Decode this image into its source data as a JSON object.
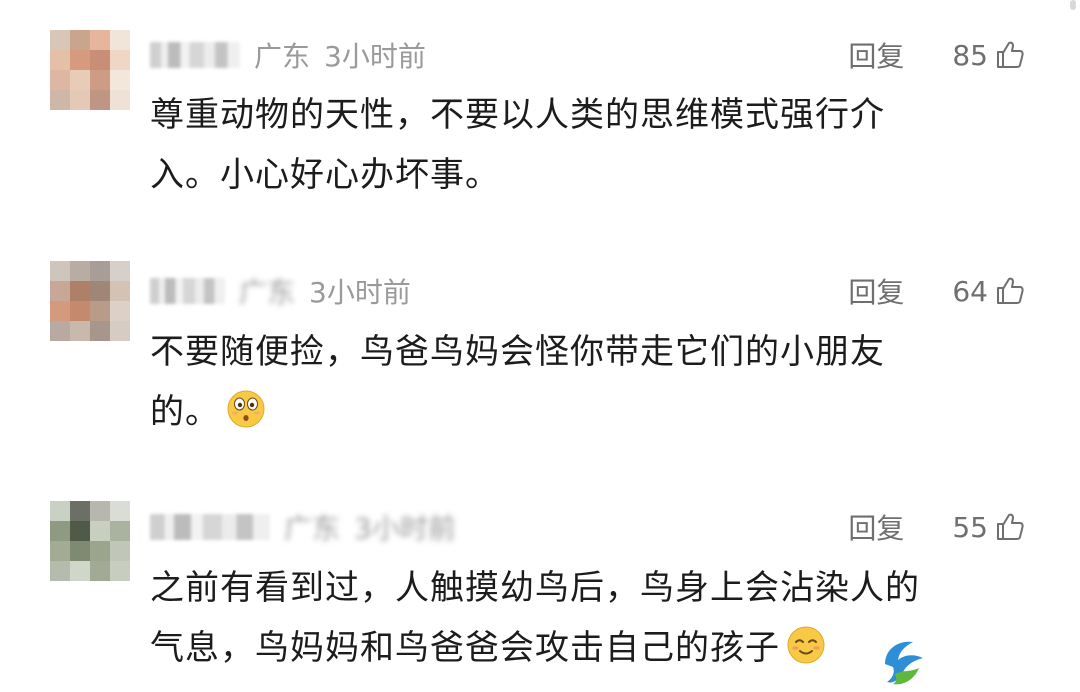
{
  "comments": [
    {
      "location": "广东",
      "time": "3小时前",
      "reply_label": "回复",
      "likes": "85",
      "text_lines": [
        "尊重动物的天性，不要以人类的思维模式强行介",
        "入。小心好心办坏事。"
      ],
      "avatar_colors": [
        "#d8c7b8",
        "#c9a58e",
        "#e7b59c",
        "#f1e4d9",
        "#e4c0a6",
        "#d69a7e",
        "#c98e77",
        "#f0d7c5",
        "#ddb7a1",
        "#e9ccb8",
        "#ce9b85",
        "#f3e6db",
        "#cdb7a8",
        "#e3c9b6",
        "#bf9684",
        "#efe1d5"
      ]
    },
    {
      "location": "广东",
      "time": "3小时前",
      "reply_label": "回复",
      "likes": "64",
      "text_lines": [
        "不要随便捡，鸟爸鸟妈会怪你带走它们的小朋友",
        "的。"
      ],
      "emoji": "wide-eyed-face",
      "avatar_colors": [
        "#cfc5bd",
        "#b9aca3",
        "#a89e97",
        "#d7d0ca",
        "#c7a896",
        "#b07f67",
        "#9f8677",
        "#d4c2b5",
        "#d49a7c",
        "#c58a6e",
        "#b99b8a",
        "#ddd1c7",
        "#b8aaa0",
        "#c9b8ac",
        "#a7968b",
        "#d6ccc4"
      ]
    },
    {
      "location": "广东",
      "time": "3小时前",
      "reply_label": "回复",
      "likes": "55",
      "text_lines": [
        "之前有看到过，人触摸幼鸟后，鸟身上会沾染人的",
        "气息，鸟妈妈和鸟爸爸会攻击自己的孩子"
      ],
      "emoji": "smiling-blush-face",
      "avatar_colors": [
        "#c9d0c4",
        "#6c6f66",
        "#b8b7ae",
        "#d9ddd6",
        "#8e9a82",
        "#4f5a49",
        "#c8cfc0",
        "#aab39f",
        "#a4ab95",
        "#7f8a72",
        "#9ba58d",
        "#c0c7b9",
        "#b6bcad",
        "#d1d6cb",
        "#a2a995",
        "#c7cdbf"
      ]
    }
  ]
}
